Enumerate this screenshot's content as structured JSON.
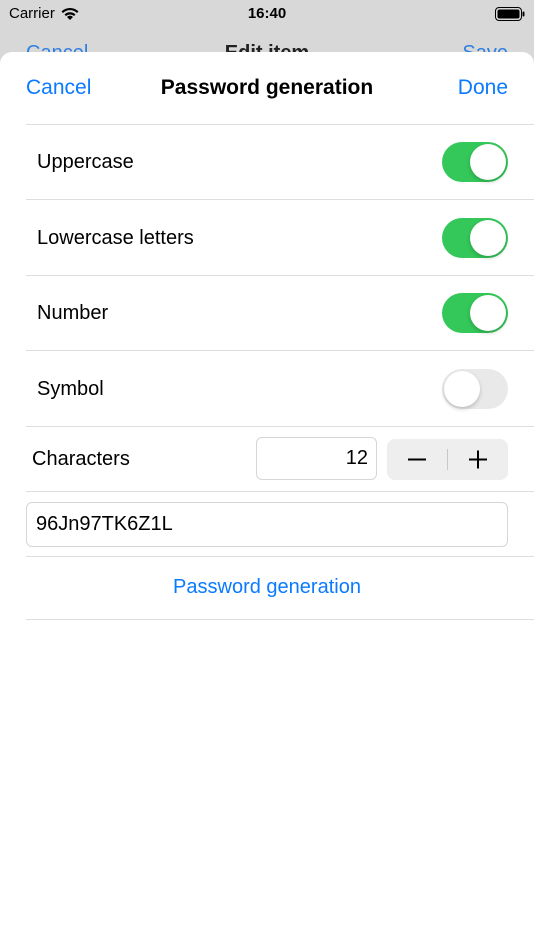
{
  "status_bar": {
    "carrier": "Carrier",
    "time": "16:40"
  },
  "underlying_nav": {
    "cancel": "Cancel",
    "title": "Edit item",
    "save": "Save"
  },
  "nav": {
    "cancel_label": "Cancel",
    "title": "Password generation",
    "done_label": "Done"
  },
  "options": [
    {
      "label": "Uppercase",
      "enabled": true
    },
    {
      "label": "Lowercase letters",
      "enabled": true
    },
    {
      "label": "Number",
      "enabled": true
    },
    {
      "label": "Symbol",
      "enabled": false
    }
  ],
  "characters": {
    "label": "Characters",
    "value": "12"
  },
  "generated_password": "96Jn97TK6Z1L",
  "generate_button_label": "Password generation",
  "colors": {
    "accent": "#0a7aff",
    "toggle_on": "#34c759",
    "toggle_off": "#e9e9ea"
  }
}
